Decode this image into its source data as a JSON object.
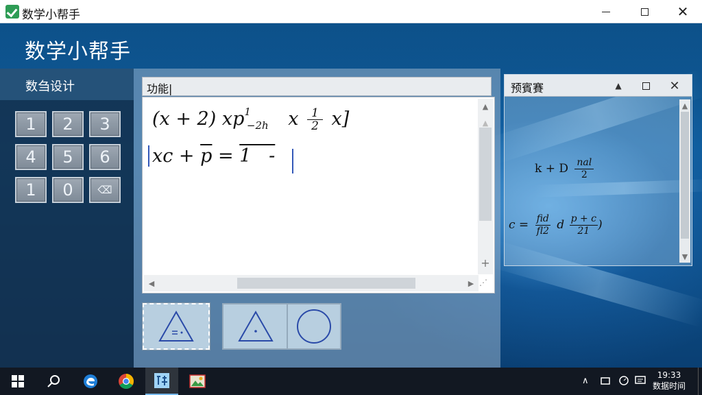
{
  "window": {
    "title": "数学小帮手",
    "minimize": "—",
    "maximize": "□",
    "close": "✕"
  },
  "app": {
    "heading": "数学小帮手"
  },
  "left_panel": {
    "header": "数刍设计",
    "keys": [
      "1",
      "2",
      "3",
      "4",
      "5",
      "6",
      "1",
      "0",
      "⌫"
    ]
  },
  "editor": {
    "header": "功能|",
    "formula_line_1": "(x + 2) xp¹₋₂ₕ  x ¹⁄₂ x]",
    "formula_line_2": "xc + p̄ = 1̄  -",
    "shapes": [
      "triangle-with-equals",
      "triangle-with-dot",
      "circle"
    ]
  },
  "preview": {
    "header": "预賓賽",
    "line_1_text": "k + D",
    "line_1_frac_top": "nal",
    "line_1_frac_bottom": "2",
    "line_2_text": "c =",
    "line_2_frac1_top": "fid",
    "line_2_frac1_bottom": "fl2",
    "line_2_d": "d",
    "line_2_frac2_top": "p + c",
    "line_2_frac2_bottom": "21"
  },
  "taskbar": {
    "time": "19:33",
    "date": "数据时间",
    "pinned": [
      "windows-start",
      "search",
      "edge",
      "chrome",
      "math-helper-app",
      "photos"
    ]
  },
  "colors": {
    "accent_blue": "#3358b8",
    "panel_dark": "#142d46",
    "taskbar": "#121822"
  }
}
